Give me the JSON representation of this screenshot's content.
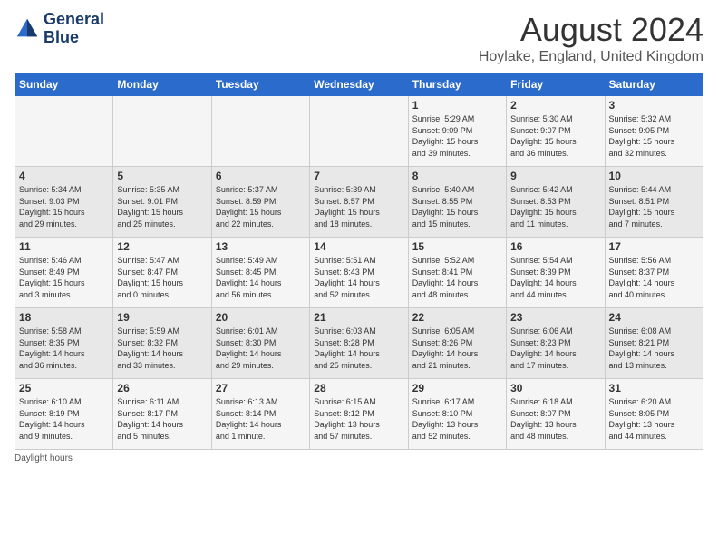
{
  "logo": {
    "line1": "General",
    "line2": "Blue"
  },
  "title": "August 2024",
  "location": "Hoylake, England, United Kingdom",
  "days_of_week": [
    "Sunday",
    "Monday",
    "Tuesday",
    "Wednesday",
    "Thursday",
    "Friday",
    "Saturday"
  ],
  "footer": "Daylight hours",
  "weeks": [
    [
      {
        "day": "",
        "info": ""
      },
      {
        "day": "",
        "info": ""
      },
      {
        "day": "",
        "info": ""
      },
      {
        "day": "",
        "info": ""
      },
      {
        "day": "1",
        "info": "Sunrise: 5:29 AM\nSunset: 9:09 PM\nDaylight: 15 hours\nand 39 minutes."
      },
      {
        "day": "2",
        "info": "Sunrise: 5:30 AM\nSunset: 9:07 PM\nDaylight: 15 hours\nand 36 minutes."
      },
      {
        "day": "3",
        "info": "Sunrise: 5:32 AM\nSunset: 9:05 PM\nDaylight: 15 hours\nand 32 minutes."
      }
    ],
    [
      {
        "day": "4",
        "info": "Sunrise: 5:34 AM\nSunset: 9:03 PM\nDaylight: 15 hours\nand 29 minutes."
      },
      {
        "day": "5",
        "info": "Sunrise: 5:35 AM\nSunset: 9:01 PM\nDaylight: 15 hours\nand 25 minutes."
      },
      {
        "day": "6",
        "info": "Sunrise: 5:37 AM\nSunset: 8:59 PM\nDaylight: 15 hours\nand 22 minutes."
      },
      {
        "day": "7",
        "info": "Sunrise: 5:39 AM\nSunset: 8:57 PM\nDaylight: 15 hours\nand 18 minutes."
      },
      {
        "day": "8",
        "info": "Sunrise: 5:40 AM\nSunset: 8:55 PM\nDaylight: 15 hours\nand 15 minutes."
      },
      {
        "day": "9",
        "info": "Sunrise: 5:42 AM\nSunset: 8:53 PM\nDaylight: 15 hours\nand 11 minutes."
      },
      {
        "day": "10",
        "info": "Sunrise: 5:44 AM\nSunset: 8:51 PM\nDaylight: 15 hours\nand 7 minutes."
      }
    ],
    [
      {
        "day": "11",
        "info": "Sunrise: 5:46 AM\nSunset: 8:49 PM\nDaylight: 15 hours\nand 3 minutes."
      },
      {
        "day": "12",
        "info": "Sunrise: 5:47 AM\nSunset: 8:47 PM\nDaylight: 15 hours\nand 0 minutes."
      },
      {
        "day": "13",
        "info": "Sunrise: 5:49 AM\nSunset: 8:45 PM\nDaylight: 14 hours\nand 56 minutes."
      },
      {
        "day": "14",
        "info": "Sunrise: 5:51 AM\nSunset: 8:43 PM\nDaylight: 14 hours\nand 52 minutes."
      },
      {
        "day": "15",
        "info": "Sunrise: 5:52 AM\nSunset: 8:41 PM\nDaylight: 14 hours\nand 48 minutes."
      },
      {
        "day": "16",
        "info": "Sunrise: 5:54 AM\nSunset: 8:39 PM\nDaylight: 14 hours\nand 44 minutes."
      },
      {
        "day": "17",
        "info": "Sunrise: 5:56 AM\nSunset: 8:37 PM\nDaylight: 14 hours\nand 40 minutes."
      }
    ],
    [
      {
        "day": "18",
        "info": "Sunrise: 5:58 AM\nSunset: 8:35 PM\nDaylight: 14 hours\nand 36 minutes."
      },
      {
        "day": "19",
        "info": "Sunrise: 5:59 AM\nSunset: 8:32 PM\nDaylight: 14 hours\nand 33 minutes."
      },
      {
        "day": "20",
        "info": "Sunrise: 6:01 AM\nSunset: 8:30 PM\nDaylight: 14 hours\nand 29 minutes."
      },
      {
        "day": "21",
        "info": "Sunrise: 6:03 AM\nSunset: 8:28 PM\nDaylight: 14 hours\nand 25 minutes."
      },
      {
        "day": "22",
        "info": "Sunrise: 6:05 AM\nSunset: 8:26 PM\nDaylight: 14 hours\nand 21 minutes."
      },
      {
        "day": "23",
        "info": "Sunrise: 6:06 AM\nSunset: 8:23 PM\nDaylight: 14 hours\nand 17 minutes."
      },
      {
        "day": "24",
        "info": "Sunrise: 6:08 AM\nSunset: 8:21 PM\nDaylight: 14 hours\nand 13 minutes."
      }
    ],
    [
      {
        "day": "25",
        "info": "Sunrise: 6:10 AM\nSunset: 8:19 PM\nDaylight: 14 hours\nand 9 minutes."
      },
      {
        "day": "26",
        "info": "Sunrise: 6:11 AM\nSunset: 8:17 PM\nDaylight: 14 hours\nand 5 minutes."
      },
      {
        "day": "27",
        "info": "Sunrise: 6:13 AM\nSunset: 8:14 PM\nDaylight: 14 hours\nand 1 minute."
      },
      {
        "day": "28",
        "info": "Sunrise: 6:15 AM\nSunset: 8:12 PM\nDaylight: 13 hours\nand 57 minutes."
      },
      {
        "day": "29",
        "info": "Sunrise: 6:17 AM\nSunset: 8:10 PM\nDaylight: 13 hours\nand 52 minutes."
      },
      {
        "day": "30",
        "info": "Sunrise: 6:18 AM\nSunset: 8:07 PM\nDaylight: 13 hours\nand 48 minutes."
      },
      {
        "day": "31",
        "info": "Sunrise: 6:20 AM\nSunset: 8:05 PM\nDaylight: 13 hours\nand 44 minutes."
      }
    ]
  ]
}
